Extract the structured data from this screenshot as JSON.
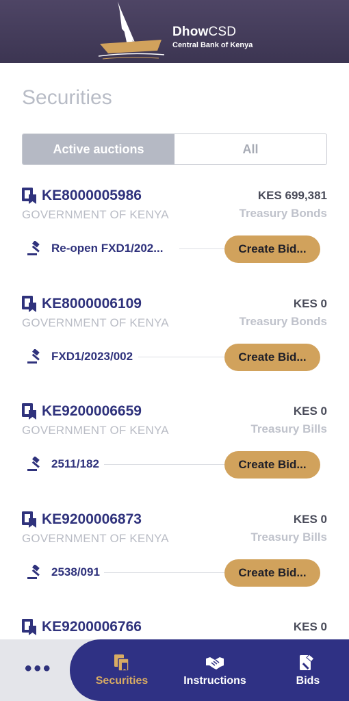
{
  "header": {
    "brand_bold": "Dhow",
    "brand_rest": "CSD",
    "subtitle": "Central Bank of Kenya"
  },
  "page": {
    "title": "Securities"
  },
  "tabs": [
    {
      "label": "Active auctions",
      "active": true
    },
    {
      "label": "All",
      "active": false
    }
  ],
  "securities": [
    {
      "code": "KE8000005986",
      "issuer": "GOVERNMENT OF KENYA",
      "amount": "KES 699,381",
      "type": "Treasury Bonds",
      "auction": "Re-open FXD1/202...",
      "action": "Create Bid..."
    },
    {
      "code": "KE8000006109",
      "issuer": "GOVERNMENT OF KENYA",
      "amount": "KES 0",
      "type": "Treasury Bonds",
      "auction": "FXD1/2023/002",
      "action": "Create Bid..."
    },
    {
      "code": "KE9200006659",
      "issuer": "GOVERNMENT OF KENYA",
      "amount": "KES 0",
      "type": "Treasury Bills",
      "auction": "2511/182",
      "action": "Create Bid..."
    },
    {
      "code": "KE9200006873",
      "issuer": "GOVERNMENT OF KENYA",
      "amount": "KES 0",
      "type": "Treasury Bills",
      "auction": "2538/091",
      "action": "Create Bid..."
    },
    {
      "code": "KE9200006766",
      "amount": "KES 0"
    }
  ],
  "bottom_nav": {
    "more": "•••",
    "items": [
      {
        "label": "Securities",
        "icon": "securities-icon",
        "active": true
      },
      {
        "label": "Instructions",
        "icon": "handshake-icon",
        "active": false
      },
      {
        "label": "Bids",
        "icon": "bids-gavel-icon",
        "active": false
      }
    ]
  },
  "colors": {
    "header_bg": "#3c3552",
    "primary": "#2f327c",
    "accent": "#d1a25c",
    "nav_bg": "#2f3184",
    "nav_active": "#d8ab63"
  }
}
